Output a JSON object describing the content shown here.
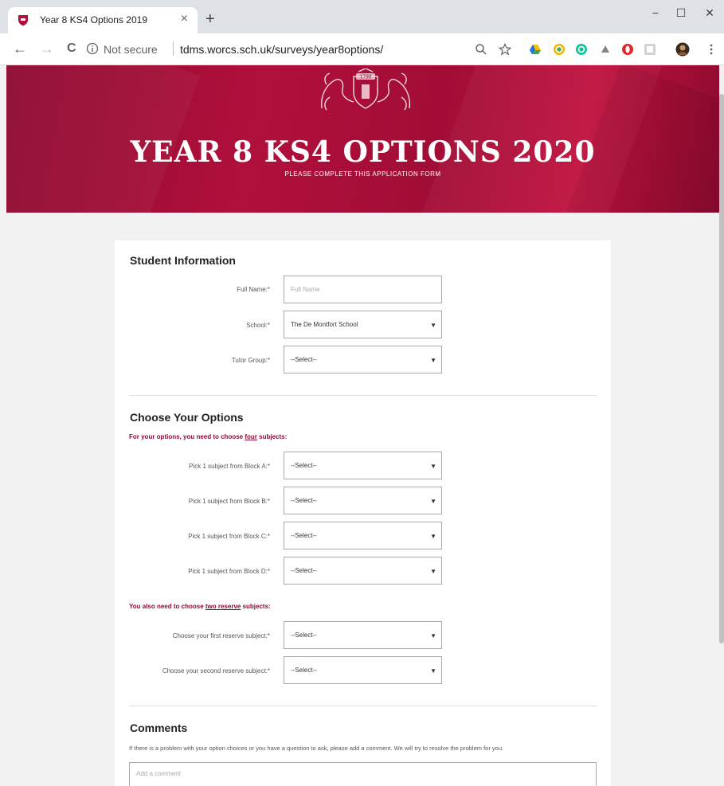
{
  "browser": {
    "tab_title": "Year 8 KS4 Options 2019",
    "tab_close": "×",
    "new_tab": "+",
    "minimize": "−",
    "maximize": "☐",
    "close": "✕",
    "back": "←",
    "forward": "→",
    "reload": "C",
    "not_secure": "Not secure",
    "url": "tdms.worcs.sch.uk/surveys/year8options/",
    "colors": {
      "tabstrip": "#dee1e6",
      "accent": "#8e0a30"
    }
  },
  "hero": {
    "title": "YEAR 8 KS4 OPTIONS 2020",
    "subtitle": "PLEASE COMPLETE THIS APPLICATION FORM",
    "crest_text": "1790"
  },
  "student_info": {
    "heading": "Student Information",
    "fields": [
      {
        "label": "Full Name:*",
        "value": "Full Name",
        "placeholder": true
      },
      {
        "label": "School:*",
        "value": "The De Montfort School",
        "caret": "▼"
      },
      {
        "label": "Tutor Group:*",
        "value": "--Select--",
        "caret": "▼"
      }
    ]
  },
  "options": {
    "heading": "Choose Your Options",
    "hint_pre": "For your options, you need to choose ",
    "hint_em": "four",
    "hint_post": " subjects:",
    "fields": [
      {
        "label": "Pick 1 subject from Block A:*",
        "value": "--Select--",
        "caret": "▼"
      },
      {
        "label": "Pick 1 subject from Block B:*",
        "value": "--Select--",
        "caret": "▼"
      },
      {
        "label": "Pick 1 subject from Block C:*",
        "value": "--Select--",
        "caret": "▼"
      },
      {
        "label": "Pick 1 subject from Block D:*",
        "value": "--Select--",
        "caret": "▼"
      }
    ],
    "reserve_hint_pre": "You also need to choose ",
    "reserve_hint_em": "two reserve",
    "reserve_hint_post": " subjects:",
    "reserve_fields": [
      {
        "label": "Choose your first reserve subject:*",
        "value": "--Select--",
        "caret": "▼"
      },
      {
        "label": "Choose your second reserve subject:*",
        "value": "--Select--",
        "caret": "▼"
      }
    ]
  },
  "comments": {
    "heading": "Comments",
    "description": "If there is a problem with your option choices or you have a question to ask, please add a comment. We will try to resolve the problem for you.",
    "placeholder": "Add a comment"
  }
}
